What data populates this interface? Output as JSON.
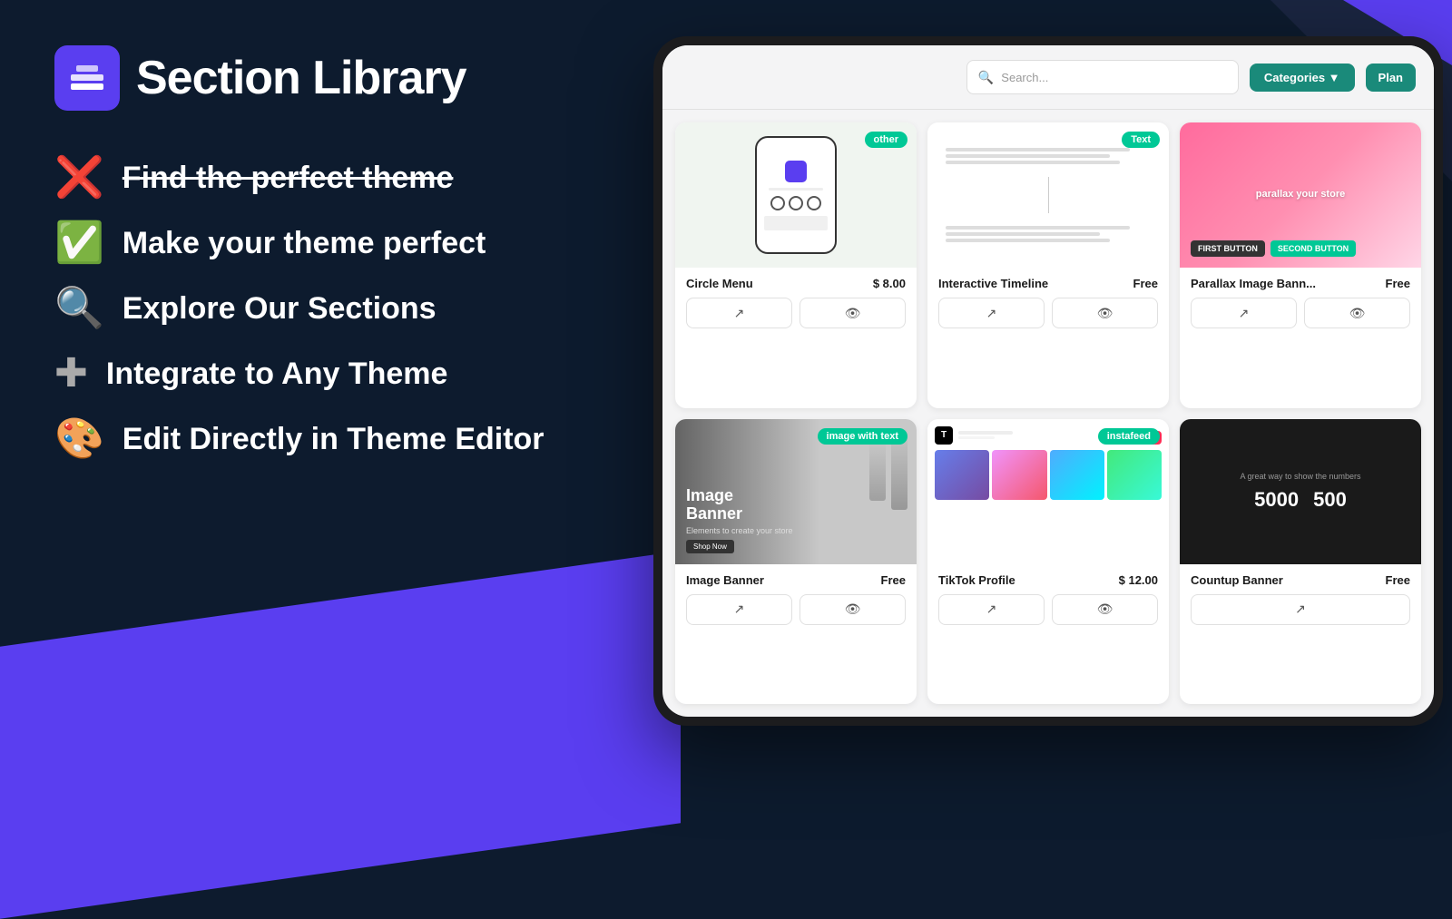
{
  "app": {
    "title": "Section Library",
    "logo_alt": "Section Library Logo"
  },
  "left": {
    "features": [
      {
        "icon": "❌",
        "text": "Find the perfect theme",
        "strikethrough": true
      },
      {
        "icon": "✅",
        "text": "Make your theme perfect",
        "strikethrough": false
      },
      {
        "icon": "🔍",
        "text": "Explore Our Sections",
        "strikethrough": false
      },
      {
        "icon": "+",
        "text": "Integrate to Any Theme",
        "strikethrough": false,
        "icon_style": "plus"
      },
      {
        "icon": "🎨",
        "text": "Edit Directly in Theme Editor",
        "strikethrough": false
      }
    ]
  },
  "app_ui": {
    "search_placeholder": "Search...",
    "categories_label": "Categories ▼",
    "plan_label": "Plan",
    "cards": [
      {
        "id": "circle-menu",
        "title": "Circle Menu",
        "price": "$ 8.00",
        "badge": "other",
        "badge_class": "badge-other"
      },
      {
        "id": "interactive-timeline",
        "title": "Interactive Timeline",
        "price": "Free",
        "badge": "Text",
        "badge_class": "badge-text"
      },
      {
        "id": "parallax-image-banner",
        "title": "Parallax Image Bann...",
        "price": "Free",
        "badge": null
      },
      {
        "id": "image-banner",
        "title": "Image Banner",
        "price": "Free",
        "badge": "image with text",
        "badge_class": "badge-image-with-text"
      },
      {
        "id": "tiktok-profile",
        "title": "TikTok Profile",
        "price": "$ 12.00",
        "badge": "instafeed",
        "badge_class": "badge-instafeed"
      },
      {
        "id": "countup-banner",
        "title": "Countup Banner",
        "price": "Free",
        "badge": null
      }
    ],
    "parallax": {
      "overlay_text": "parallax your store",
      "btn1": "FIRST BUTTON",
      "btn2": "SECOND BUTTON"
    },
    "banner": {
      "title": "Image\nBanner",
      "subtitle": "Elements to create your store",
      "shop_btn": "Shop Now"
    },
    "countup": {
      "subtitle": "A great way to show the numbers",
      "num1": "5000",
      "num2": "500",
      "label1": "",
      "label2": ""
    }
  }
}
